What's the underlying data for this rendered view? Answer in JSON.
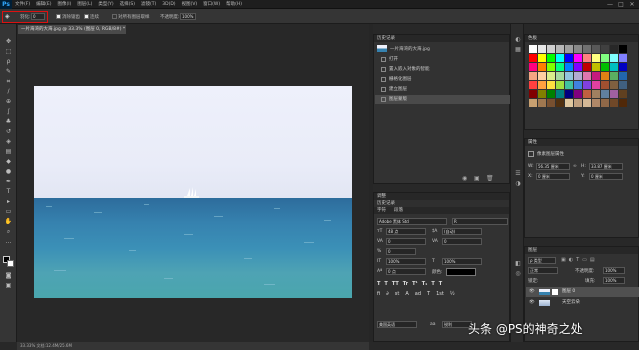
{
  "app": {
    "logo": "Ps",
    "minimize": "—",
    "maximize": "□",
    "close": "✕"
  },
  "menu": [
    "文件(F)",
    "编辑(E)",
    "图像(I)",
    "图层(L)",
    "类型(Y)",
    "选择(S)",
    "滤镜(T)",
    "3D(D)",
    "视图(V)",
    "窗口(W)",
    "帮助(H)"
  ],
  "options": {
    "feather_label": "羽化:",
    "feather_value": "0",
    "antialias_label": "消除锯齿",
    "contiguous_label": "连续",
    "all_layers_label": "对所有图层取样",
    "opacity_label": "不透明度:",
    "opacity_value": "100%"
  },
  "document": {
    "tab_title": "一片海湾的大海.jpg @ 33.3% (图层 0, RGB/8#) *",
    "status": "33.33%   文档:12.4M/25.6M"
  },
  "history": {
    "title": "历史记录",
    "snapshot": "一片海湾的大海.jpg",
    "items": [
      "打开",
      "置入嵌入对象的智能",
      "栅格化图层",
      "建立图层",
      "图层蒙版"
    ]
  },
  "swatches": {
    "title": "色板",
    "colors": [
      "#ffffff",
      "#e8e8e8",
      "#d0d0d0",
      "#b8b8b8",
      "#a0a0a0",
      "#888888",
      "#707070",
      "#585858",
      "#404040",
      "#282828",
      "#000000",
      "#ff0000",
      "#ffff00",
      "#00ff00",
      "#00ffff",
      "#0000ff",
      "#ff00ff",
      "#ff8080",
      "#ffff80",
      "#80ff80",
      "#80ffff",
      "#8080ff",
      "#ff0080",
      "#ff8000",
      "#80ff00",
      "#00ff80",
      "#0080ff",
      "#8000ff",
      "#c00000",
      "#c0c000",
      "#00c000",
      "#00c0c0",
      "#0000c0",
      "#f4a582",
      "#fdd0a2",
      "#d9ef8b",
      "#a6dba0",
      "#92c5de",
      "#b2abd2",
      "#de77ae",
      "#c51b7d",
      "#e08214",
      "#5aae61",
      "#2166ac",
      "#ff4040",
      "#ffa040",
      "#ffe040",
      "#a0e040",
      "#40c0a0",
      "#4080e0",
      "#8040e0",
      "#e040a0",
      "#a05030",
      "#806040",
      "#406080",
      "#800000",
      "#808000",
      "#008000",
      "#008080",
      "#000080",
      "#800080",
      "#c06040",
      "#a08060",
      "#6080a0",
      "#a060a0",
      "#604020",
      "#c8a070",
      "#a07850",
      "#785030",
      "#503010",
      "#e0c8a0",
      "#c0a080",
      "#d4b896",
      "#b08868",
      "#906848",
      "#704828",
      "#502808"
    ]
  },
  "properties": {
    "title": "属性",
    "kind": "像素图层属性",
    "w_label": "W:",
    "w_value": "56.35 厘米",
    "link": "∞",
    "h_label": "H:",
    "h_value": "33.87 厘米",
    "x_label": "X:",
    "x_value": "0 厘米",
    "y_label": "Y:",
    "y_value": "0 厘米"
  },
  "character": {
    "title1": "调整",
    "title2": "字符",
    "title3": "段落",
    "font": "Adobe 黑体 Std",
    "style": "R",
    "size": "48 点",
    "leading": "(自动)",
    "kerning": "0",
    "tracking": "0",
    "scale_v": "100%",
    "scale_h": "100%",
    "baseline": "0 点",
    "color_label": "颜色:",
    "styles": [
      "T",
      "T",
      "TT",
      "Tr",
      "T¹",
      "T₁",
      "T",
      "T"
    ],
    "lang": "美国英语",
    "aa": "锐利"
  },
  "layers": {
    "title": "图层",
    "kind": "ρ 类型",
    "mode": "正常",
    "opacity_label": "不透明度:",
    "opacity_value": "100%",
    "lock_label": "锁定:",
    "fill_label": "填充:",
    "fill_value": "100%",
    "items": [
      {
        "name": "图层 0"
      },
      {
        "name": "天空云朵"
      }
    ]
  },
  "watermark": "头条 @PS的神奇之处"
}
